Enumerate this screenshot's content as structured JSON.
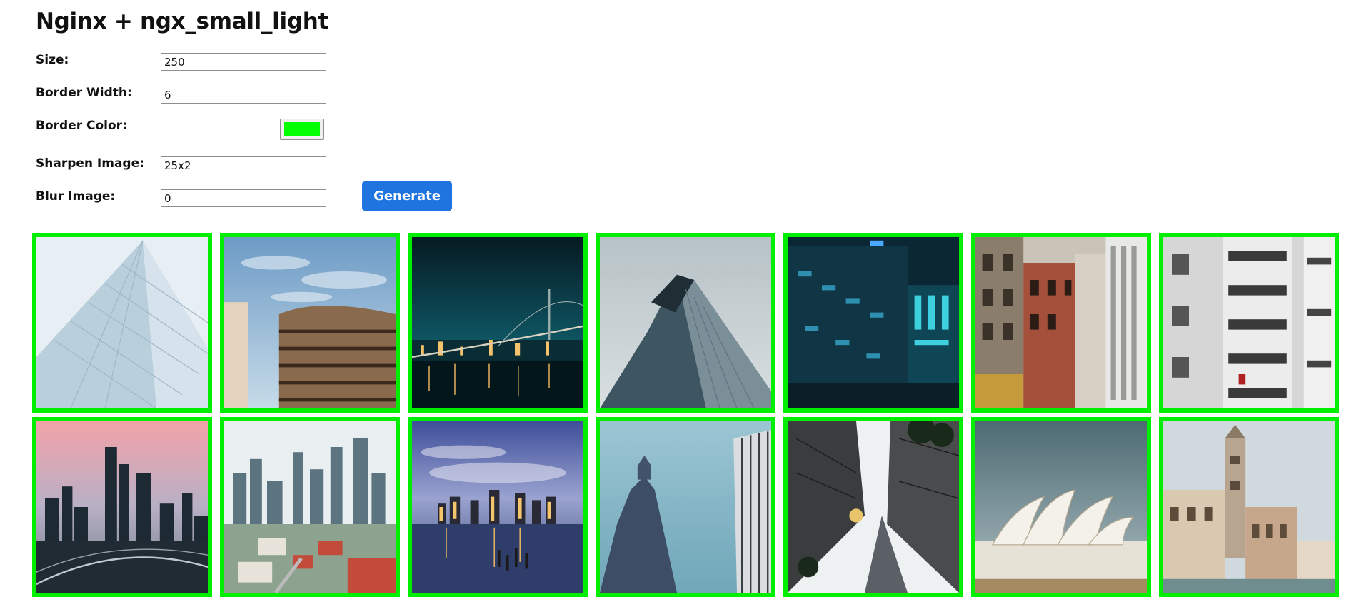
{
  "title": "Nginx + ngx_small_light",
  "form": {
    "size": {
      "label": "Size:",
      "value": "250"
    },
    "border_width": {
      "label": "Border Width:",
      "value": "6"
    },
    "border_color": {
      "label": "Border Color:",
      "value": "#00ff00"
    },
    "sharpen": {
      "label": "Sharpen Image:",
      "value": "25x2"
    },
    "blur": {
      "label": "Blur Image:",
      "value": "0"
    },
    "generate_label": "Generate"
  },
  "colors": {
    "accent": "#1f74e0",
    "image_border": "#00ee00"
  },
  "gallery": [
    {
      "name": "glass-facade-photo"
    },
    {
      "name": "curved-office-building-photo"
    },
    {
      "name": "bay-bridge-night-photo"
    },
    {
      "name": "glass-skyscraper-looking-up-photo"
    },
    {
      "name": "lit-office-building-night-photo"
    },
    {
      "name": "brick-street-buildings-photo"
    },
    {
      "name": "apartment-balconies-photo"
    },
    {
      "name": "city-skyline-sunset-photo"
    },
    {
      "name": "singapore-skyline-photo"
    },
    {
      "name": "manhattan-skyline-dusk-photo"
    },
    {
      "name": "gothic-tower-and-skyscraper-photo"
    },
    {
      "name": "skyscrapers-from-below-photo"
    },
    {
      "name": "sydney-opera-house-photo"
    },
    {
      "name": "venice-bell-tower-photo"
    }
  ]
}
